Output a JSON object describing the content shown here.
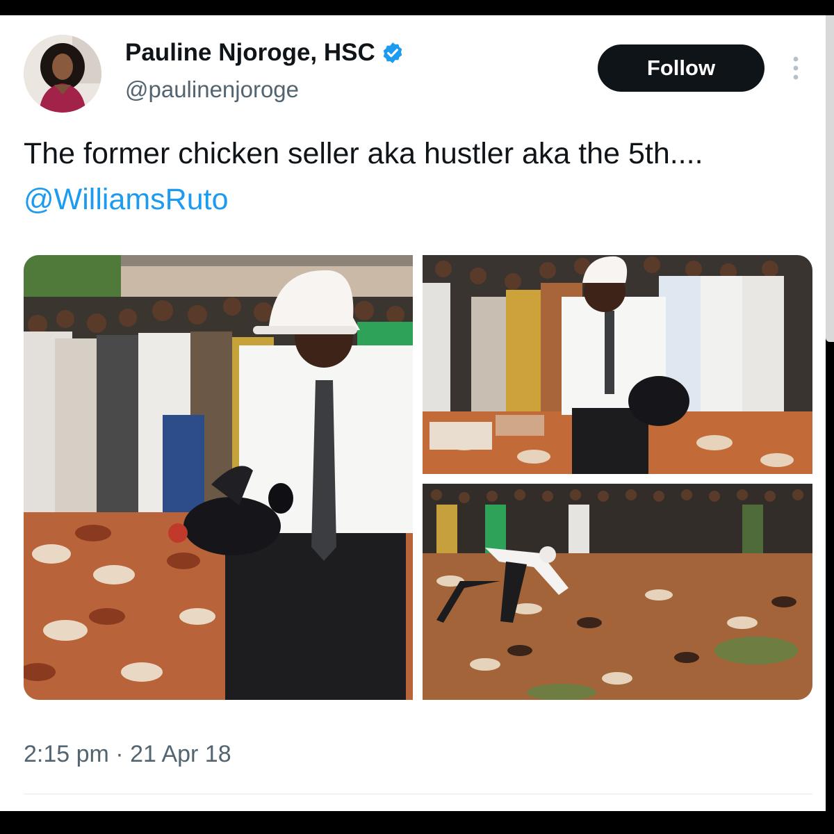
{
  "tweet": {
    "author": {
      "display_name": "Pauline Njoroge, HSC",
      "handle": "@paulinenjoroge",
      "verified": true
    },
    "follow_label": "Follow",
    "text": "The former chicken seller aka hustler aka the 5th....",
    "mention": "@WilliamsRuto",
    "timestamp": "2:15 pm · 21 Apr 18"
  },
  "icons": {
    "verified": "verified-badge-icon",
    "more": "more-options-icon"
  },
  "colors": {
    "accent_blue": "#1d9bf0",
    "follow_button": "#0f1419",
    "secondary_text": "#536471"
  }
}
